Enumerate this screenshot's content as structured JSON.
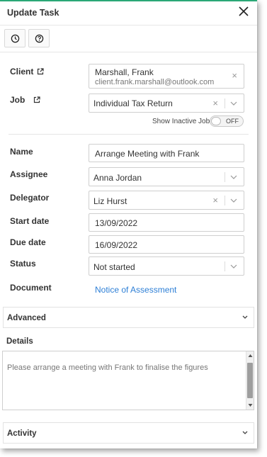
{
  "header": {
    "title": "Update Task"
  },
  "toolbar": {
    "icons": [
      "clock-icon",
      "help-icon"
    ]
  },
  "form": {
    "client_label": "Client",
    "client_name": "Marshall, Frank",
    "client_email": "client.frank.marshall@outlook.com",
    "job_label": "Job",
    "job_value": "Individual Tax Return",
    "show_inactive_label": "Show Inactive Jobs",
    "toggle_text": "OFF",
    "name_label": "Name",
    "name_value": "Arrange Meeting with Frank",
    "assignee_label": "Assignee",
    "assignee_value": "Anna Jordan",
    "delegator_label": "Delegator",
    "delegator_value": "Liz Hurst",
    "start_label": "Start date",
    "start_value": "13/09/2022",
    "due_label": "Due date",
    "due_value": "16/09/2022",
    "status_label": "Status",
    "status_value": "Not started",
    "document_label": "Document",
    "document_link": "Notice of Assessment"
  },
  "sections": {
    "advanced": "Advanced",
    "details": "Details",
    "details_placeholder": "Please arrange a meeting with Frank to finalise the figures",
    "activity": "Activity"
  },
  "colors": {
    "accent": "#2aa876",
    "link": "#2d7fd6"
  }
}
